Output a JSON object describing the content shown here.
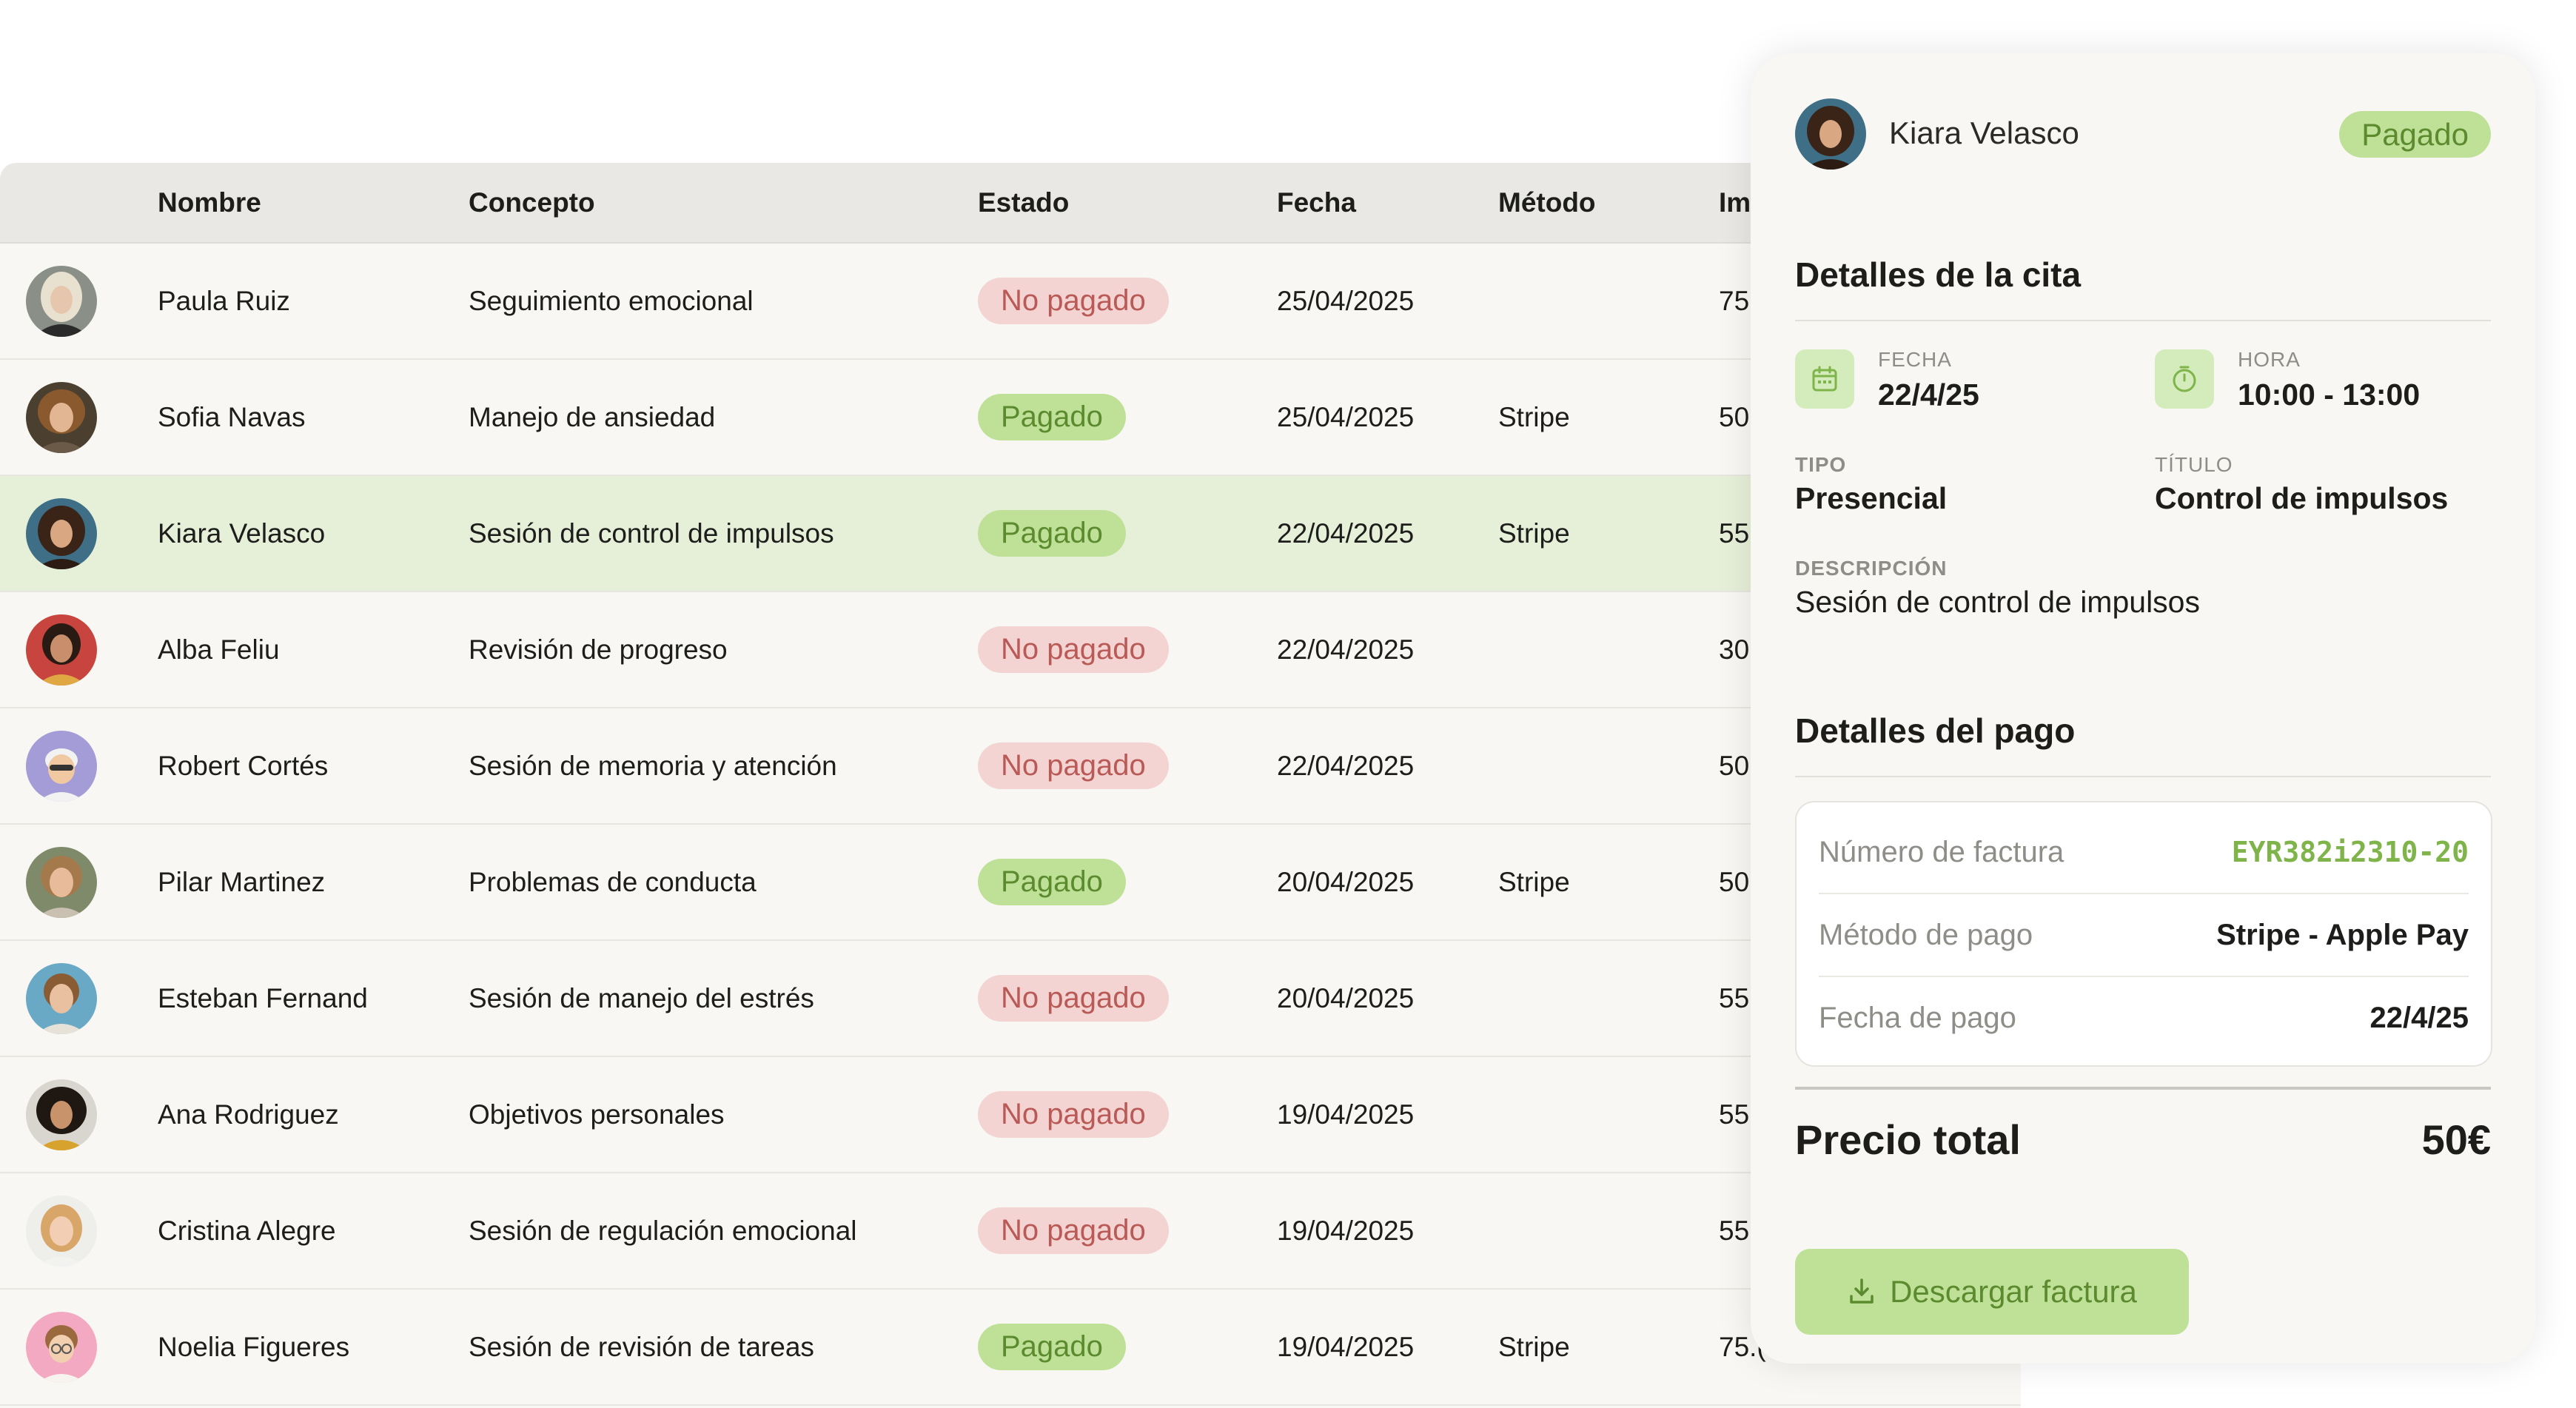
{
  "table": {
    "headers": [
      "Nombre",
      "Concepto",
      "Estado",
      "Fecha",
      "Método",
      "Im"
    ],
    "rows": [
      {
        "name": "Paula Ruiz",
        "concept": "Seguimiento emocional",
        "status": "No pagado",
        "paid": false,
        "date": "25/04/2025",
        "method": "",
        "amount": "75."
      },
      {
        "name": "Sofia Navas",
        "concept": "Manejo de ansiedad",
        "status": "Pagado",
        "paid": true,
        "date": "25/04/2025",
        "method": "Stripe",
        "amount": "50"
      },
      {
        "name": "Kiara Velasco",
        "concept": "Sesión de control de impulsos",
        "status": "Pagado",
        "paid": true,
        "date": "22/04/2025",
        "method": "Stripe",
        "amount": "55"
      },
      {
        "name": "Alba Feliu",
        "concept": "Revisión de progreso",
        "status": "No pagado",
        "paid": false,
        "date": "22/04/2025",
        "method": "",
        "amount": "30"
      },
      {
        "name": "Robert Cortés",
        "concept": "Sesión de memoria y atención",
        "status": "No pagado",
        "paid": false,
        "date": "22/04/2025",
        "method": "",
        "amount": "50"
      },
      {
        "name": "Pilar Martinez",
        "concept": "Problemas de conducta",
        "status": "Pagado",
        "paid": true,
        "date": "20/04/2025",
        "method": "Stripe",
        "amount": "50"
      },
      {
        "name": "Esteban Fernand",
        "concept": "Sesión de manejo del estrés",
        "status": "No pagado",
        "paid": false,
        "date": "20/04/2025",
        "method": "",
        "amount": "55"
      },
      {
        "name": "Ana Rodriguez",
        "concept": "Objetivos personales",
        "status": "No pagado",
        "paid": false,
        "date": "19/04/2025",
        "method": "",
        "amount": "55"
      },
      {
        "name": "Cristina Alegre",
        "concept": "Sesión de regulación emocional",
        "status": "No pagado",
        "paid": false,
        "date": "19/04/2025",
        "method": "",
        "amount": "55"
      },
      {
        "name": "Noelia Figueres",
        "concept": "Sesión de revisión de tareas",
        "status": "Pagado",
        "paid": true,
        "date": "19/04/2025",
        "method": "Stripe",
        "amount": "75.("
      }
    ]
  },
  "detail": {
    "name": "Kiara Velasco",
    "status": "Pagado",
    "appointment_title": "Detalles de la cita",
    "date_label": "FECHA",
    "date_value": "22/4/25",
    "time_label": "HORA",
    "time_value": "10:00 - 13:00",
    "type_label": "TIPO",
    "type_value": "Presencial",
    "title_label": "TÍTULO",
    "title_value": "Control de impulsos",
    "description_label": "DESCRIPCIÓN",
    "description_value": "Sesión de control de impulsos",
    "payment_title": "Detalles del pago",
    "invoice_label": "Número de factura",
    "invoice_value": "EYR382i2310-20",
    "method_label": "Método de pago",
    "method_value": "Stripe - Apple Pay",
    "payment_date_label": "Fecha de pago",
    "payment_date_value": "22/4/25",
    "total_label": "Precio total",
    "total_value": "50€",
    "download_label": "Descargar factura"
  },
  "icons": {
    "calendar": "calendar-icon",
    "timer": "timer-icon",
    "download": "download-icon"
  },
  "colors": {
    "paid_bg": "#bfe197",
    "paid_text": "#5c8b2f",
    "unpaid_bg": "#f3d4d2",
    "unpaid_text": "#b95a57",
    "selected_row": "#e6efd8",
    "invoice_accent": "#7fb44a"
  }
}
